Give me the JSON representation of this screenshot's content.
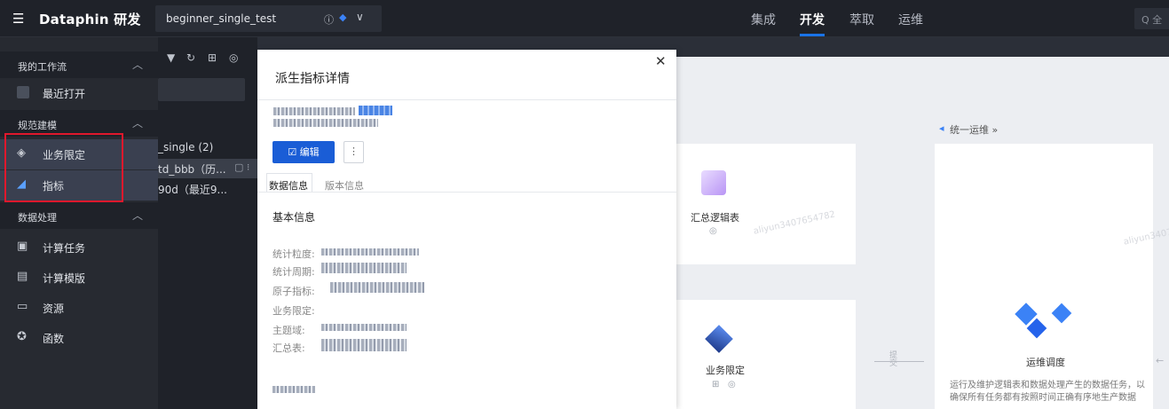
{
  "topbar": {
    "app_title": "Dataphin 研发",
    "project": "beginner_single_test",
    "nav": [
      "集成",
      "开发",
      "萃取",
      "运维"
    ],
    "active_nav": "开发",
    "search_placeholder": "Q 全"
  },
  "sidebar": {
    "groups": [
      {
        "label": "我的工作流"
      },
      {
        "label": "规范建模"
      },
      {
        "label": "数据处理"
      }
    ],
    "items": [
      {
        "label": "最近打开",
        "icon": "recent-icon"
      },
      {
        "label": "业务限定",
        "icon": "layers-icon"
      },
      {
        "label": "指标",
        "icon": "metric-chart-icon"
      },
      {
        "label": "计算任务",
        "icon": "terminal-icon"
      },
      {
        "label": "计算模版",
        "icon": "template-icon"
      },
      {
        "label": "资源",
        "icon": "resource-icon"
      },
      {
        "label": "函数",
        "icon": "function-icon"
      }
    ]
  },
  "tree": {
    "rows": [
      "_single (2)",
      "td_bbb（历...",
      "90d（最近9..."
    ]
  },
  "drawer": {
    "title": "派生指标详情",
    "edit_label": "编辑",
    "more_label": "⋮",
    "tabs": [
      "数据信息",
      "版本信息"
    ],
    "section_title": "基本信息",
    "fields": [
      "统计粒度:",
      "统计周期:",
      "原子指标:",
      "业务限定:",
      "主题域:",
      "汇总表:"
    ]
  },
  "canvas": {
    "section_header": "统一运维 »",
    "node_summary_table": "汇总逻辑表",
    "node_business_filter": "业务限定",
    "node_ops_schedule": "运维调度",
    "arrow_label": "提交",
    "ops_description": "运行及维护逻辑表和数据处理产生的数据任务，以确保所有任务都有按照时间正确有序地生产数据",
    "watermark": "aliyun3407654782"
  },
  "colors": {
    "topbar_bg": "#1f2229",
    "accent_blue": "#1a5dd6",
    "highlight_red": "#e0182c"
  }
}
